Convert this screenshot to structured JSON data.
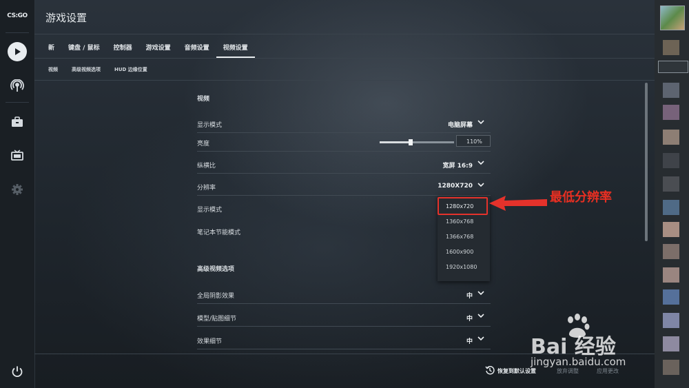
{
  "app": {
    "logo_text": "CS:GO",
    "title": "游戏设置"
  },
  "tabs": [
    {
      "label": "新",
      "active": false
    },
    {
      "label": "键盘 / 鼠标",
      "active": false
    },
    {
      "label": "控制器",
      "active": false
    },
    {
      "label": "游戏设置",
      "active": false
    },
    {
      "label": "音频设置",
      "active": false
    },
    {
      "label": "视频设置",
      "active": true
    }
  ],
  "subtabs": [
    "视频",
    "高级视频选项",
    "HUD 边缘位置"
  ],
  "video": {
    "section_title": "视频",
    "rows": {
      "display_mode": {
        "label": "显示模式",
        "value": "电脑屏幕"
      },
      "brightness": {
        "label": "亮度",
        "value": "110%",
        "level_percent": 42
      },
      "aspect_ratio": {
        "label": "纵横比",
        "value": "宽屏 16:9"
      },
      "resolution": {
        "label": "分辨率",
        "value": "1280X720"
      },
      "display_mode2": {
        "label": "显示模式"
      },
      "laptop_power": {
        "label": "笔记本节能模式"
      }
    },
    "resolution_options": [
      "1280x720",
      "1360x768",
      "1366x768",
      "1600x900",
      "1920x1080"
    ]
  },
  "advanced": {
    "section_title": "高级视频选项",
    "rows": [
      {
        "label": "全局阴影效果",
        "value": "中"
      },
      {
        "label": "模型/贴图细节",
        "value": "中"
      },
      {
        "label": "效果细节",
        "value": "中"
      }
    ]
  },
  "annotation": {
    "text": "最低分辨率",
    "color": "#e82f22"
  },
  "footer": {
    "reset": "恢复到默认设置",
    "discard": "放弃调整",
    "apply": "应用更改"
  },
  "watermark": {
    "brand": "Bai 经验",
    "url": "jingyan.baidu.com"
  },
  "icons": [
    "play-icon",
    "broadcast-icon",
    "briefcase-icon",
    "tv-icon",
    "gear-icon",
    "power-icon",
    "chevron-down-icon",
    "reset-icon"
  ]
}
